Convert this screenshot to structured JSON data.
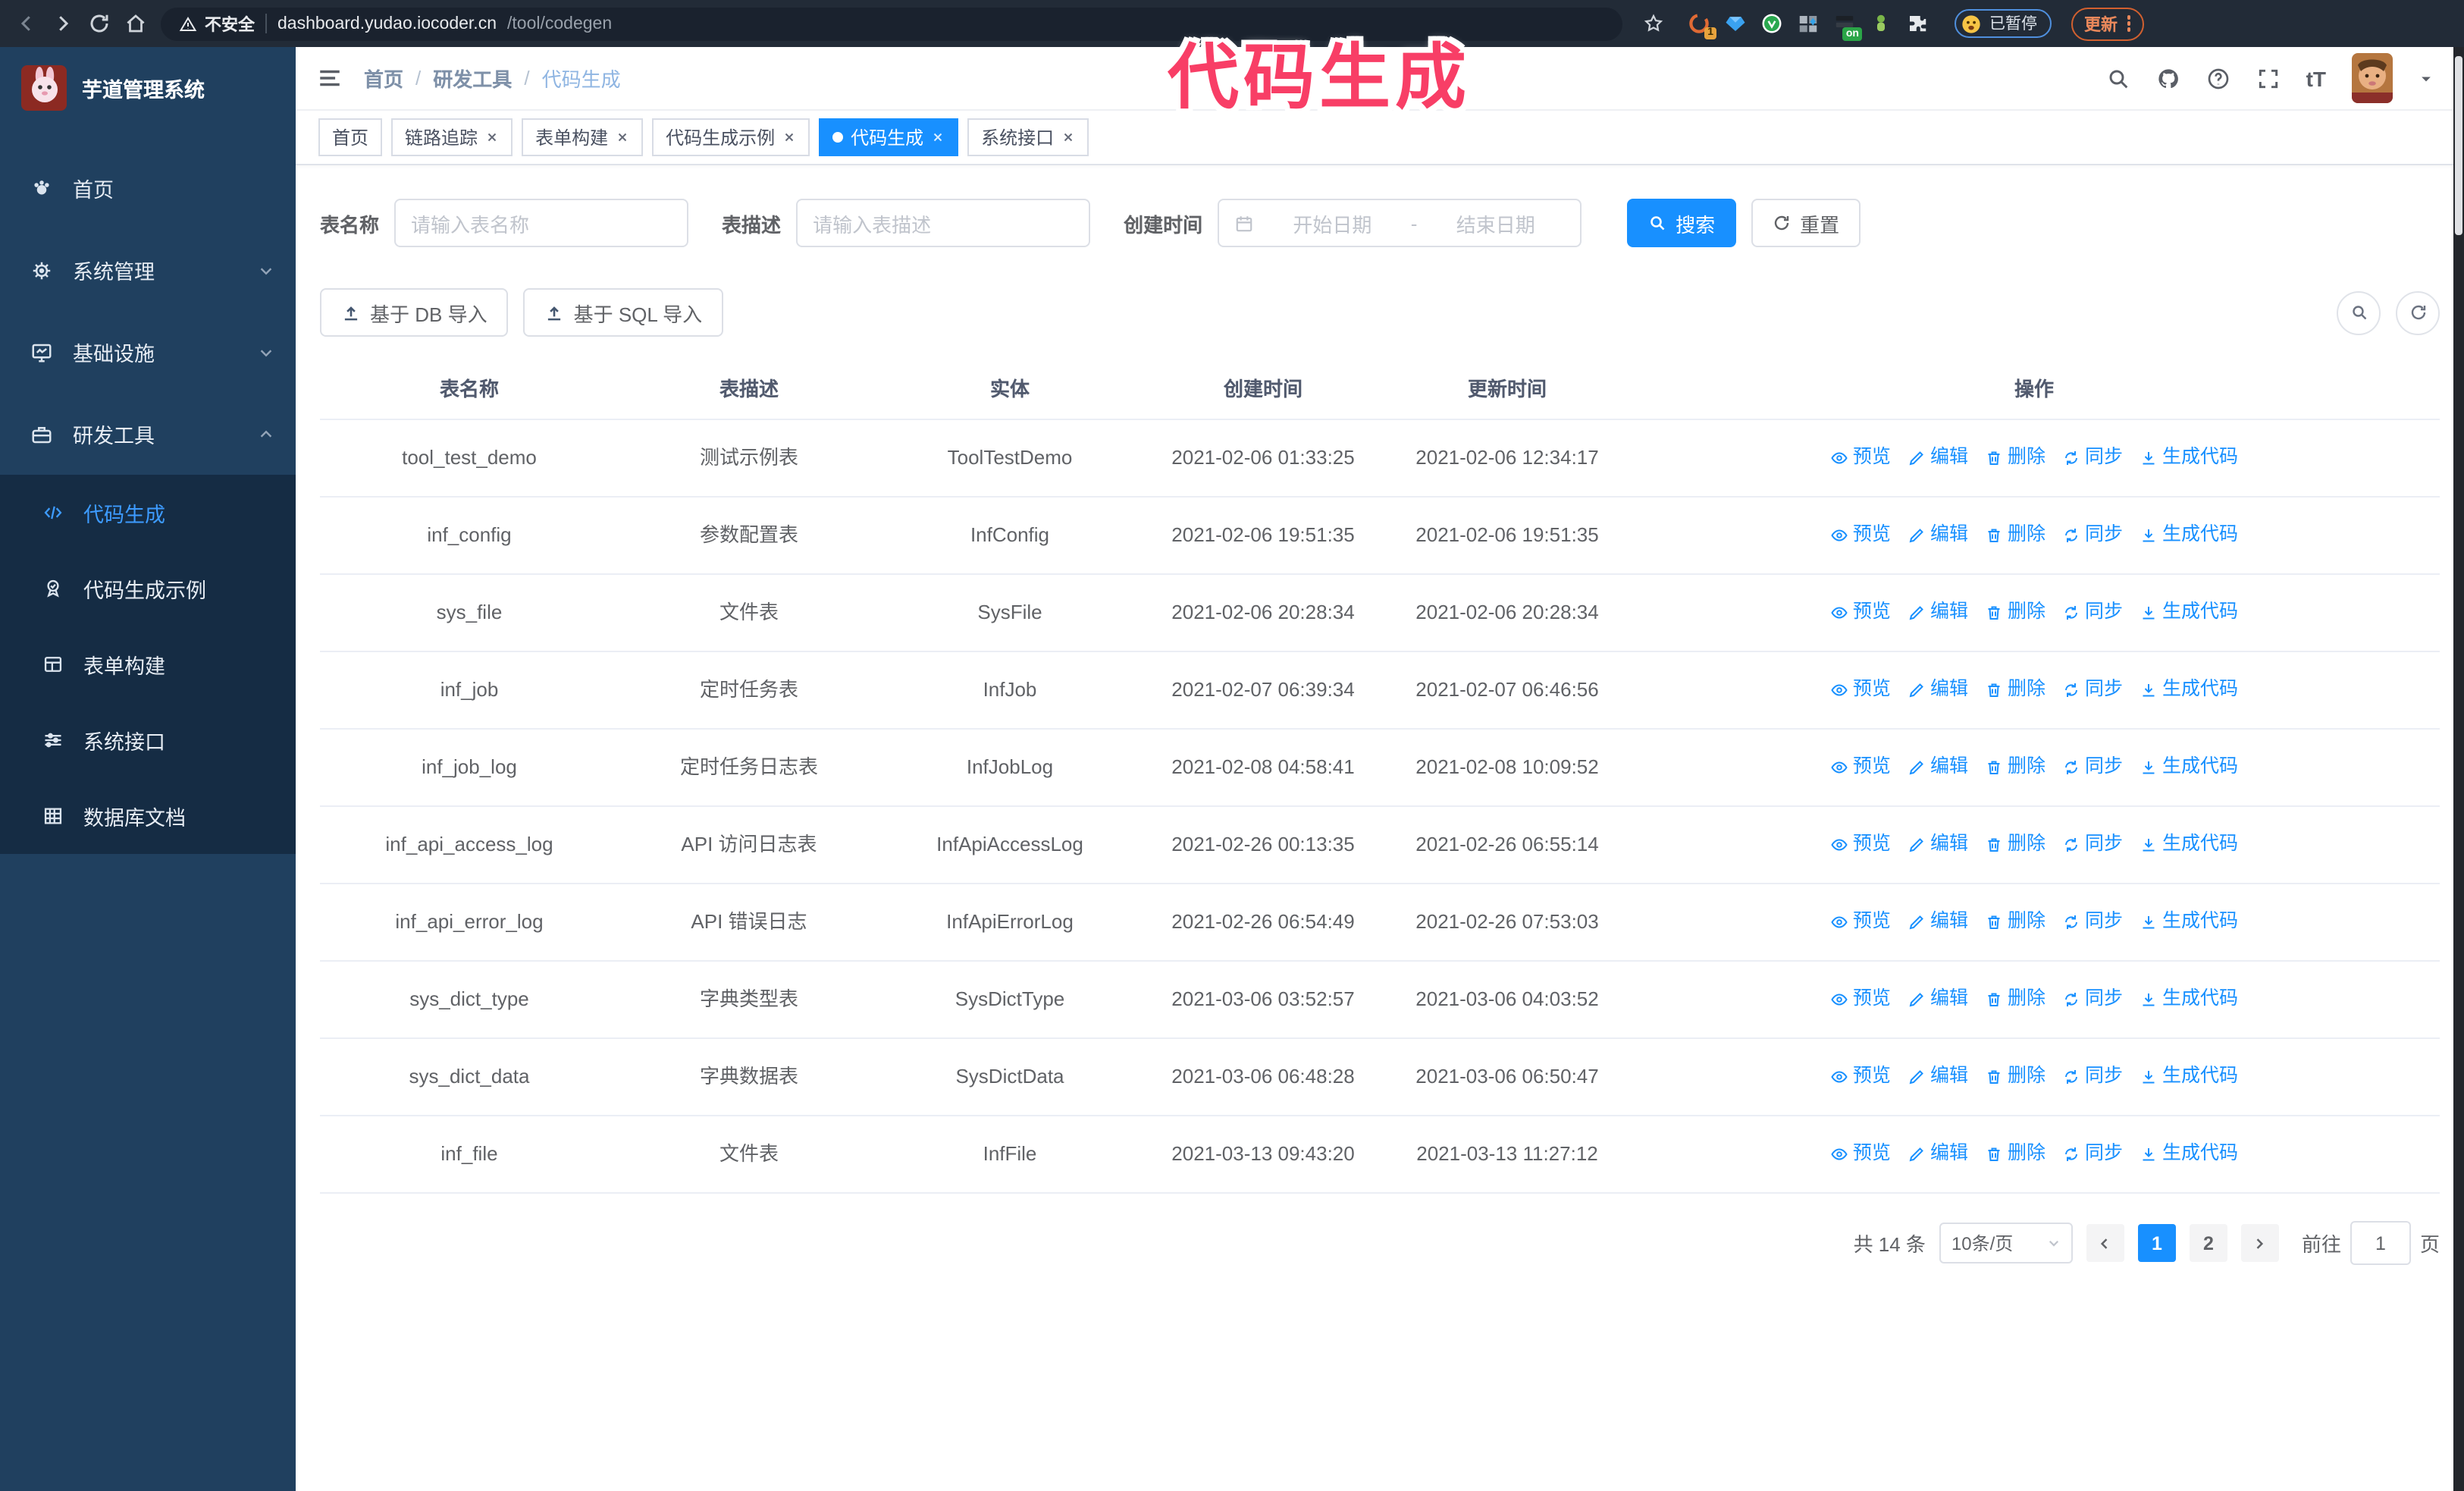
{
  "colors": {
    "accent": "#1890ff",
    "sidebar_bg": "#20405f",
    "submenu_bg": "#152c44",
    "annotation_pink": "#f83e66",
    "browser_bar": "#222b37"
  },
  "browser": {
    "security_chip": "不安全",
    "url_host": "dashboard.yudao.iocoder.cn",
    "url_path": "/tool/codegen",
    "ext_badge_count": "1",
    "ext_badge_on": "on",
    "profile_badge": "已暂停",
    "update_button": "更新"
  },
  "annotation": {
    "text": "代码生成"
  },
  "sidebar": {
    "logo_title": "芋道管理系统",
    "items": [
      {
        "label": "首页"
      },
      {
        "label": "系统管理"
      },
      {
        "label": "基础设施"
      },
      {
        "label": "研发工具"
      }
    ],
    "submenu": [
      {
        "label": "代码生成"
      },
      {
        "label": "代码生成示例"
      },
      {
        "label": "表单构建"
      },
      {
        "label": "系统接口"
      },
      {
        "label": "数据库文档"
      }
    ]
  },
  "header": {
    "breadcrumb": [
      "首页",
      "研发工具",
      "代码生成"
    ],
    "separator": "/",
    "text_size_icon": "tT"
  },
  "tabs": [
    {
      "label": "首页"
    },
    {
      "label": "链路追踪"
    },
    {
      "label": "表单构建"
    },
    {
      "label": "代码生成示例"
    },
    {
      "label": "代码生成"
    },
    {
      "label": "系统接口"
    }
  ],
  "filters": {
    "table_name_label": "表名称",
    "table_name_placeholder": "请输入表名称",
    "table_desc_label": "表描述",
    "table_desc_placeholder": "请输入表描述",
    "create_time_label": "创建时间",
    "date_start_placeholder": "开始日期",
    "date_separator": "-",
    "date_end_placeholder": "结束日期",
    "search_button": "搜索",
    "reset_button": "重置"
  },
  "toolbar": {
    "import_db": "基于 DB 导入",
    "import_sql": "基于 SQL 导入"
  },
  "table": {
    "columns": [
      "表名称",
      "表描述",
      "实体",
      "创建时间",
      "更新时间",
      "操作"
    ],
    "ops": [
      "预览",
      "编辑",
      "删除",
      "同步",
      "生成代码"
    ],
    "rows": [
      {
        "name": "tool_test_demo",
        "desc": "测试示例表",
        "entity": "ToolTestDemo",
        "created": "2021-02-06 01:33:25",
        "updated": "2021-02-06 12:34:17"
      },
      {
        "name": "inf_config",
        "desc": "参数配置表",
        "entity": "InfConfig",
        "created": "2021-02-06 19:51:35",
        "updated": "2021-02-06 19:51:35"
      },
      {
        "name": "sys_file",
        "desc": "文件表",
        "entity": "SysFile",
        "created": "2021-02-06 20:28:34",
        "updated": "2021-02-06 20:28:34"
      },
      {
        "name": "inf_job",
        "desc": "定时任务表",
        "entity": "InfJob",
        "created": "2021-02-07 06:39:34",
        "updated": "2021-02-07 06:46:56"
      },
      {
        "name": "inf_job_log",
        "desc": "定时任务日志表",
        "entity": "InfJobLog",
        "created": "2021-02-08 04:58:41",
        "updated": "2021-02-08 10:09:52"
      },
      {
        "name": "inf_api_access_log",
        "desc": "API 访问日志表",
        "entity": "InfApiAccessLog",
        "created": "2021-02-26 00:13:35",
        "updated": "2021-02-26 06:55:14"
      },
      {
        "name": "inf_api_error_log",
        "desc": "API 错误日志",
        "entity": "InfApiErrorLog",
        "created": "2021-02-26 06:54:49",
        "updated": "2021-02-26 07:53:03"
      },
      {
        "name": "sys_dict_type",
        "desc": "字典类型表",
        "entity": "SysDictType",
        "created": "2021-03-06 03:52:57",
        "updated": "2021-03-06 04:03:52"
      },
      {
        "name": "sys_dict_data",
        "desc": "字典数据表",
        "entity": "SysDictData",
        "created": "2021-03-06 06:48:28",
        "updated": "2021-03-06 06:50:47"
      },
      {
        "name": "inf_file",
        "desc": "文件表",
        "entity": "InfFile",
        "created": "2021-03-13 09:43:20",
        "updated": "2021-03-13 11:27:12"
      }
    ]
  },
  "pagination": {
    "total": "共 14 条",
    "page_size": "10条/页",
    "pages": [
      "1",
      "2"
    ],
    "goto_label": "前往",
    "goto_value": "1",
    "goto_suffix": "页"
  }
}
